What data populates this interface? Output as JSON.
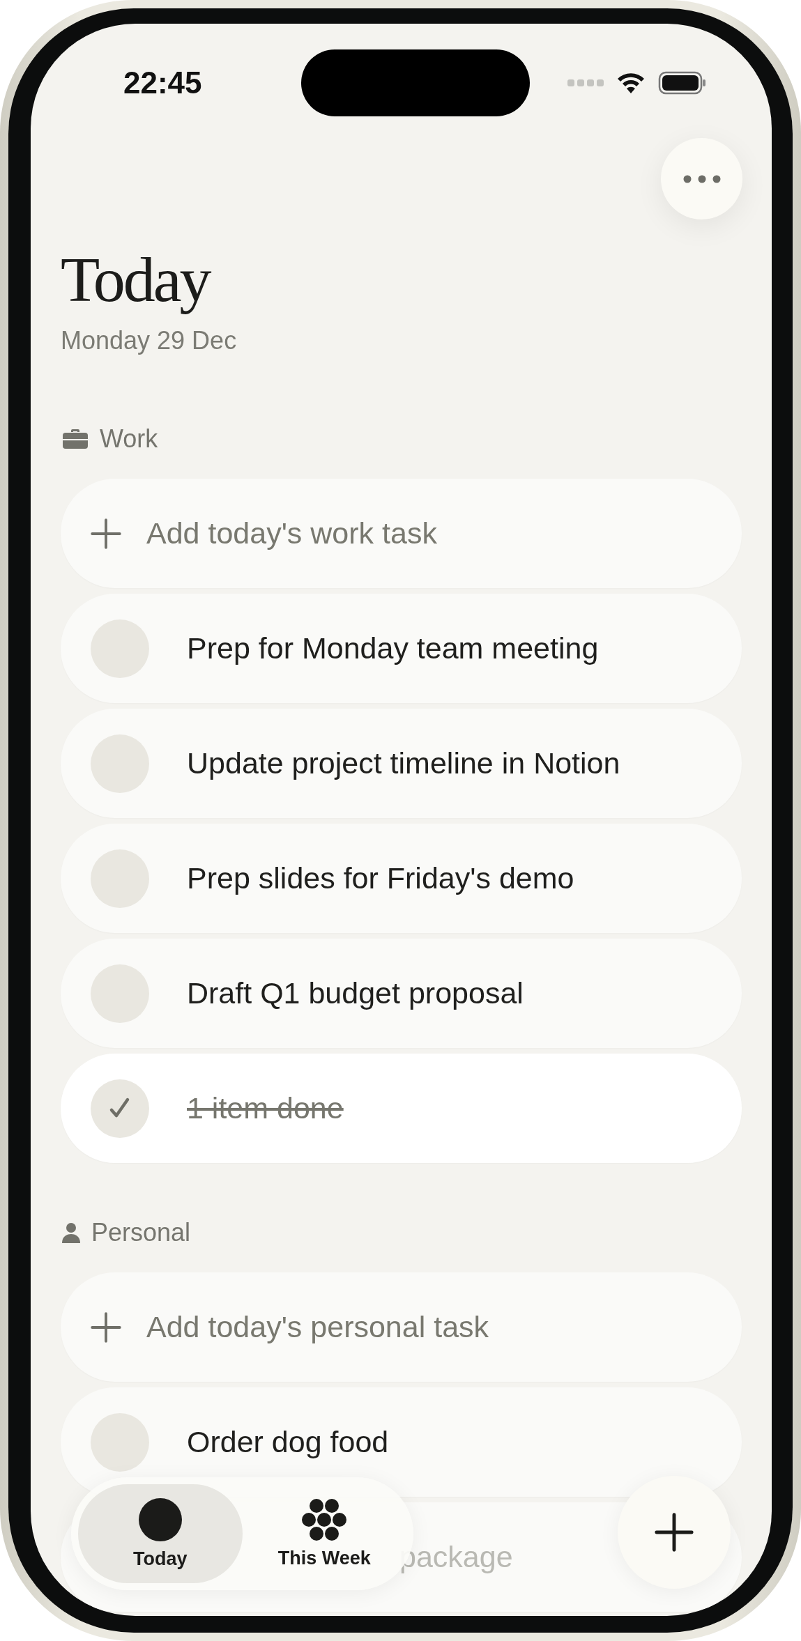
{
  "status_bar": {
    "time": "22:45"
  },
  "header": {
    "title": "Today",
    "date": "Monday 29 Dec"
  },
  "sections": [
    {
      "kind": "work",
      "title": "Work",
      "items": [
        {
          "kind": "add",
          "text": "Add today's work task"
        },
        {
          "kind": "task",
          "text": "Prep for Monday team meeting",
          "checked": false
        },
        {
          "kind": "task",
          "text": "Update project timeline in Notion",
          "checked": false
        },
        {
          "kind": "task",
          "text": "Prep slides for Friday's demo",
          "checked": false
        },
        {
          "kind": "task",
          "text": "Draft Q1 budget proposal",
          "checked": false
        },
        {
          "kind": "task",
          "text": "1 item done",
          "checked": true
        }
      ]
    },
    {
      "kind": "personal",
      "title": "Personal",
      "items": [
        {
          "kind": "add",
          "text": "Add today's personal task"
        },
        {
          "kind": "task",
          "text": "Order dog food",
          "checked": false
        },
        {
          "kind": "partial",
          "text": "package"
        }
      ]
    }
  ],
  "tab_bar": {
    "tabs": [
      {
        "label": "Today",
        "selected": true
      },
      {
        "label": "This Week",
        "selected": false
      }
    ]
  }
}
